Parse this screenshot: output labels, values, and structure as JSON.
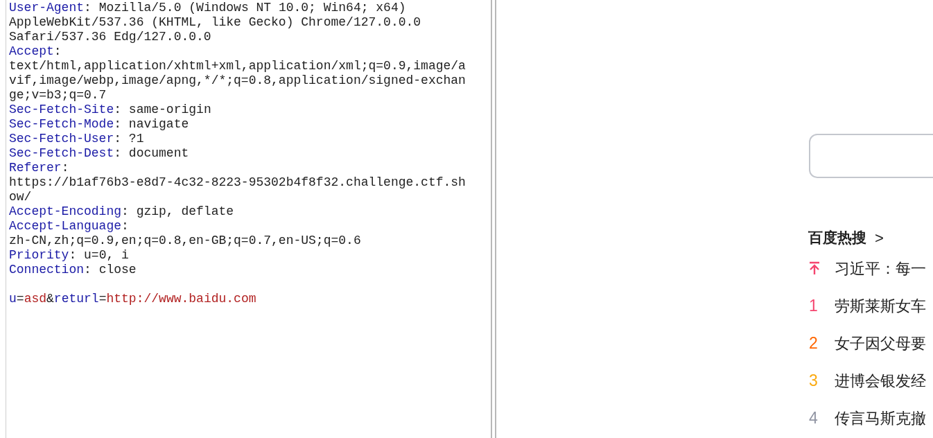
{
  "request_editor": {
    "rows": [
      {
        "name": "User-Agent",
        "sep": ":",
        "value": "Mozilla/5.0 (Windows NT 10.0; Win64; x64)"
      },
      {
        "value": "AppleWebKit/537.36 (KHTML, like Gecko) Chrome/127.0.0.0"
      },
      {
        "value": "Safari/537.36 Edg/127.0.0.0"
      },
      {
        "name": "Accept",
        "sep": ":"
      },
      {
        "value": "text/html,application/xhtml+xml,application/xml;q=0.9,image/a"
      },
      {
        "value": "vif,image/webp,image/apng,*/*;q=0.8,application/signed-exchan"
      },
      {
        "value": "ge;v=b3;q=0.7"
      },
      {
        "name": "Sec-Fetch-Site",
        "sep": ":",
        "value": "same-origin"
      },
      {
        "name": "Sec-Fetch-Mode",
        "sep": ":",
        "value": "navigate"
      },
      {
        "name": "Sec-Fetch-User",
        "sep": ":",
        "value": "?1"
      },
      {
        "name": "Sec-Fetch-Dest",
        "sep": ":",
        "value": "document"
      },
      {
        "name": "Referer",
        "sep": ":"
      },
      {
        "value": "https://b1af76b3-e8d7-4c32-8223-95302b4f8f32.challenge.ctf.sh"
      },
      {
        "value": "ow/"
      },
      {
        "name": "Accept-Encoding",
        "sep": ":",
        "value": "gzip, deflate"
      },
      {
        "name": "Accept-Language",
        "sep": ":"
      },
      {
        "value": "zh-CN,zh;q=0.9,en;q=0.8,en-GB;q=0.7,en-US;q=0.6"
      },
      {
        "name": "Priority",
        "sep": ":",
        "value": "u=0, i"
      },
      {
        "name": "Connection",
        "sep": ":",
        "value": "close"
      },
      {},
      {
        "body": [
          {
            "kind": "key",
            "text": "u"
          },
          {
            "kind": "op",
            "text": "="
          },
          {
            "kind": "val",
            "text": "asd"
          },
          {
            "kind": "op",
            "text": "&"
          },
          {
            "kind": "key",
            "text": "returl"
          },
          {
            "kind": "op",
            "text": "="
          },
          {
            "kind": "val",
            "text": "http://www.baidu.com"
          }
        ]
      }
    ]
  },
  "preview": {
    "hot_search": {
      "title": "百度热搜",
      "arrow": ">",
      "items": [
        {
          "kind": "pinned",
          "text": "习近平：每一"
        },
        {
          "kind": "number",
          "rank": "1",
          "color": "#f5456f",
          "text": "劳斯莱斯女车"
        },
        {
          "kind": "number",
          "rank": "2",
          "color": "#ff6600",
          "text": "女子因父母要"
        },
        {
          "kind": "number",
          "rank": "3",
          "color": "#faa90e",
          "text": "进博会银发经"
        },
        {
          "kind": "number",
          "rank": "4",
          "color": "#9195a3",
          "text": "传言马斯克撤"
        }
      ]
    }
  }
}
